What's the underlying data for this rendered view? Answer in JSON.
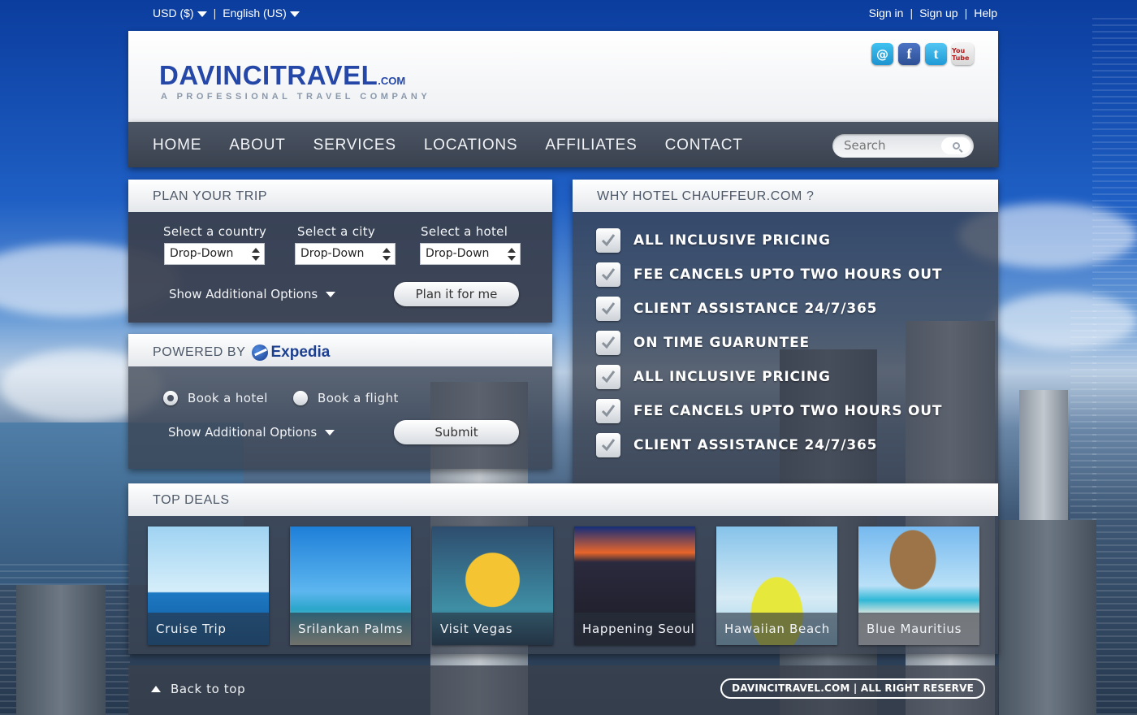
{
  "topbar": {
    "currency": "USD ($)",
    "language": "English (US)",
    "separator": "|",
    "sign_in": "Sign in",
    "sign_up": "Sign up",
    "help": "Help"
  },
  "header": {
    "logo_main": "DAVINCITRAVEL",
    "logo_suffix": ".COM",
    "tagline": "A PROFESSIONAL TRAVEL COMPANY",
    "social": [
      {
        "icon": "email-icon",
        "glyph": "@"
      },
      {
        "icon": "facebook-icon",
        "glyph": "f"
      },
      {
        "icon": "twitter-icon",
        "glyph": "t"
      },
      {
        "icon": "youtube-icon",
        "glyph": "You Tube"
      }
    ]
  },
  "nav": {
    "items": [
      "HOME",
      "ABOUT",
      "SERVICES",
      "LOCATIONS",
      "AFFILIATES",
      "CONTACT"
    ],
    "search_placeholder": "Search"
  },
  "plan": {
    "title": "PLAN YOUR TRIP",
    "country_label": "Select a country",
    "city_label": "Select a city",
    "hotel_label": "Select a hotel",
    "country_value": "Drop-Down",
    "city_value": "Drop-Down",
    "hotel_value": "Drop-Down",
    "more_options": "Show Additional Options",
    "button": "Plan it for me"
  },
  "powered": {
    "title": "POWERED BY",
    "brand": "Expedia",
    "radio_hotel": "Book a hotel",
    "radio_flight": "Book a flight",
    "selected": "hotel",
    "more_options": "Show Additional Options",
    "button": "Submit"
  },
  "why": {
    "title": "WHY HOTEL CHAUFFEUR.COM ?",
    "items": [
      "ALL INCLUSIVE PRICING",
      "FEE CANCELS UPTO TWO HOURS OUT",
      "CLIENT ASSISTANCE 24/7/365",
      "ON TIME GUARUNTEE",
      "ALL INCLUSIVE PRICING",
      "FEE CANCELS UPTO TWO HOURS OUT",
      "CLIENT ASSISTANCE 24/7/365"
    ]
  },
  "deals": {
    "title": "TOP DEALS",
    "items": [
      "Cruise Trip",
      "Srilankan Palms",
      "Visit Vegas",
      "Happening Seoul",
      "Hawaiian Beach",
      "Blue Mauritius"
    ]
  },
  "footer": {
    "back_to_top": "Back to top",
    "copyright": "DAVINCITRAVEL.COM  | ALL RIGHT RESERVE"
  }
}
